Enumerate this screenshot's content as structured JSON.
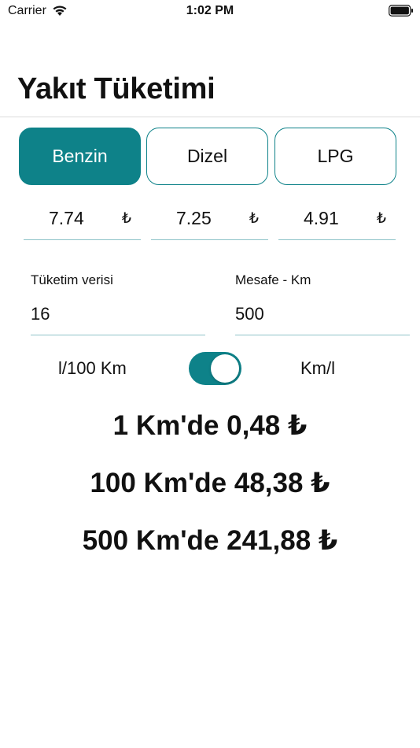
{
  "status_bar": {
    "carrier": "Carrier",
    "time": "1:02 PM"
  },
  "title": "Yakıt Tüketimi",
  "fuel_types": [
    {
      "label": "Benzin",
      "active": true
    },
    {
      "label": "Dizel",
      "active": false
    },
    {
      "label": "LPG",
      "active": false
    }
  ],
  "prices": [
    {
      "value": "7.74",
      "currency": "₺"
    },
    {
      "value": "7.25",
      "currency": "₺"
    },
    {
      "value": "4.91",
      "currency": "₺"
    }
  ],
  "consumption": {
    "label": "Tüketim verisi",
    "value": "16"
  },
  "distance": {
    "label": "Mesafe - Km",
    "value": "500"
  },
  "unit_toggle": {
    "left_label": "l/100 Km",
    "right_label": "Km/l",
    "on": true
  },
  "results": [
    "1 Km'de 0,48 ₺",
    "100 Km'de 48,38 ₺",
    "500 Km'de 241,88 ₺"
  ],
  "colors": {
    "accent": "#0e8289",
    "underline": "#8fc4c8"
  }
}
